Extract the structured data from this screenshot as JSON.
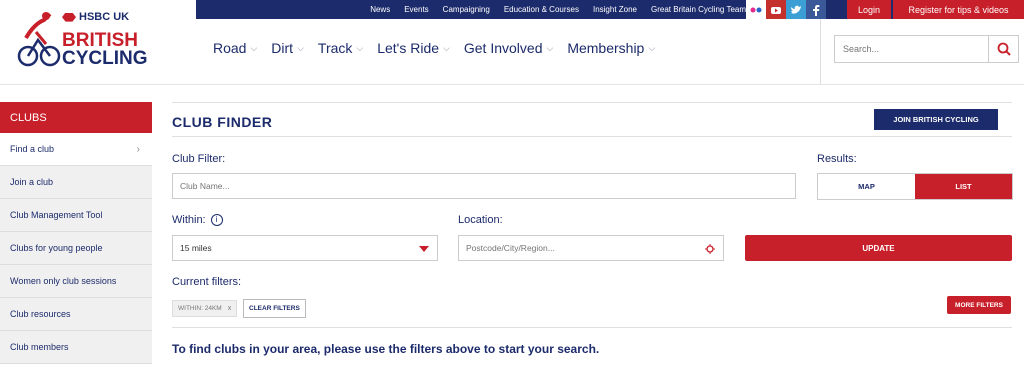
{
  "topnav": {
    "links": [
      "News",
      "Events",
      "Campaigning",
      "Education & Courses",
      "Insight Zone",
      "Great Britain Cycling Team"
    ],
    "login": "Login",
    "register": "Register for tips & videos"
  },
  "brand": {
    "sponsor": "HSBC UK",
    "line1": "BRITISH",
    "line2": "CYCLING"
  },
  "mainnav": {
    "items": [
      "Road",
      "Dirt",
      "Track",
      "Let's Ride",
      "Get Involved",
      "Membership"
    ]
  },
  "search": {
    "placeholder": "Search..."
  },
  "sidebar": {
    "heading": "CLUBS",
    "items": [
      "Find a club",
      "Join a club",
      "Club Management Tool",
      "Clubs for young people",
      "Women only club sessions",
      "Club resources",
      "Club members"
    ]
  },
  "finder": {
    "title": "CLUB FINDER",
    "join_button": "JOIN BRITISH CYCLING",
    "club_filter_label": "Club Filter:",
    "club_filter_placeholder": "Club Name...",
    "results_label": "Results:",
    "results_options": [
      "MAP",
      "LIST"
    ],
    "within_label": "Within:",
    "within_value": "15 miles",
    "location_label": "Location:",
    "location_placeholder": "Postcode/City/Region...",
    "update_button": "UPDATE",
    "current_filters_label": "Current filters:",
    "chip_label": "WITHIN: 24KM",
    "chip_remove": "x",
    "clear_filters": "CLEAR FILTERS",
    "more_filters": "MORE FILTERS",
    "message": "To find clubs in your area, please use the filters above to start your search."
  },
  "colors": {
    "navy": "#1c2b6b",
    "red": "#c8202a"
  }
}
